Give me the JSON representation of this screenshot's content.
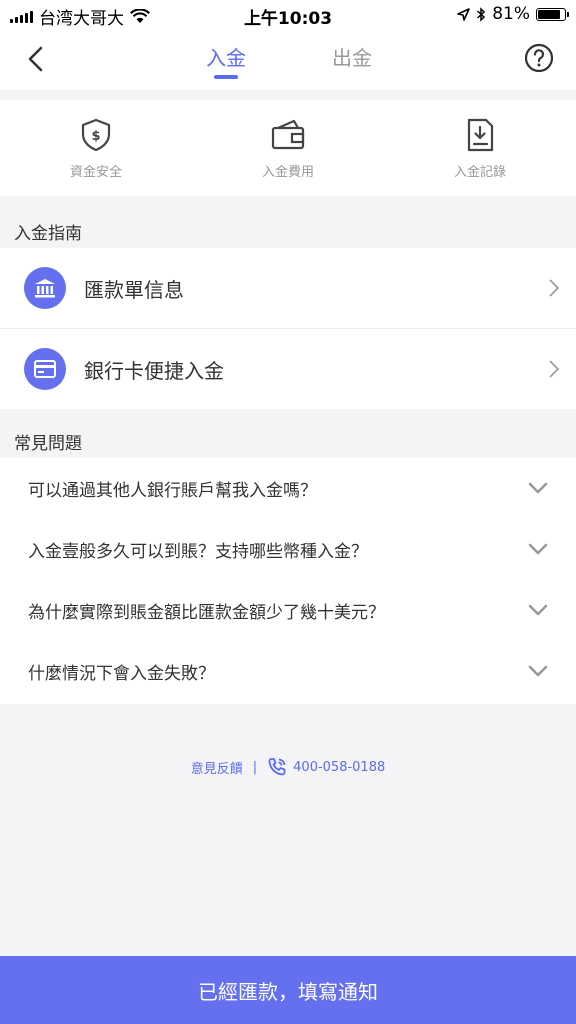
{
  "status": {
    "carrier": "台湾大哥大",
    "time": "上午10:03",
    "battery": "81%"
  },
  "nav": {
    "tab_active": "入金",
    "tab_inactive": "出金"
  },
  "quick_actions": [
    {
      "label": "資金安全",
      "icon": "shield-dollar-icon"
    },
    {
      "label": "入金費用",
      "icon": "wallet-icon"
    },
    {
      "label": "入金記錄",
      "icon": "document-download-icon"
    }
  ],
  "guide": {
    "title": "入金指南",
    "items": [
      {
        "label": "匯款單信息",
        "icon": "bank-icon"
      },
      {
        "label": "銀行卡便捷入金",
        "icon": "card-icon"
      }
    ]
  },
  "faq": {
    "title": "常見問題",
    "items": [
      {
        "question": "可以通過其他人銀行賬戶幫我入金嗎？"
      },
      {
        "question": "入金壹般多久可以到賬？支持哪些幣種入金？"
      },
      {
        "question": "為什麼實際到賬金額比匯款金額少了幾十美元？"
      },
      {
        "question": "什麼情況下會入金失敗？"
      }
    ]
  },
  "contact": {
    "feedback": "意見反饋",
    "separator": "|",
    "phone": "400-058-0188"
  },
  "submit_label": "已經匯款，填寫通知",
  "colors": {
    "accent": "#5b6cf0",
    "button": "#6470ee",
    "background": "#f4f4f7"
  }
}
